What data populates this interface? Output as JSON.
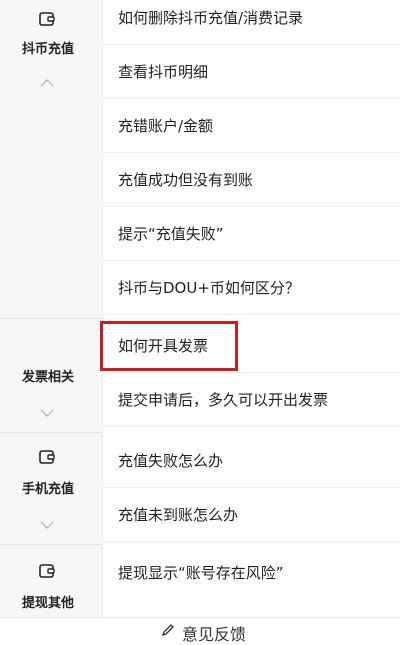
{
  "sidebar": {
    "categories": [
      {
        "label": "抖币充值",
        "icon": "wallet-icon",
        "state": "expanded"
      },
      {
        "label": "发票相关",
        "icon": "",
        "state": "collapsed"
      },
      {
        "label": "手机充值",
        "icon": "wallet-icon",
        "state": "collapsed"
      },
      {
        "label": "提现其他",
        "icon": "wallet-icon",
        "state": "collapsed"
      }
    ]
  },
  "questions": [
    {
      "text": "如何删除抖币充值/消费记录"
    },
    {
      "text": "查看抖币明细"
    },
    {
      "text": "充错账户/金额"
    },
    {
      "text": "充值成功但没有到账"
    },
    {
      "text": "提示“充值失败”"
    },
    {
      "text": "抖币与DOU+币如何区分？"
    },
    {
      "text": "如何开具发票"
    },
    {
      "text": "提交申请后，多久可以开出发票"
    },
    {
      "text": "充值失败怎么办"
    },
    {
      "text": "充值未到账怎么办"
    },
    {
      "text": "提现显示“账号存在风险”"
    }
  ],
  "footer": {
    "feedback_label": "意见反馈"
  },
  "colors": {
    "highlight": "#c91f1f",
    "sidebar_bg": "#f7f7f7"
  }
}
